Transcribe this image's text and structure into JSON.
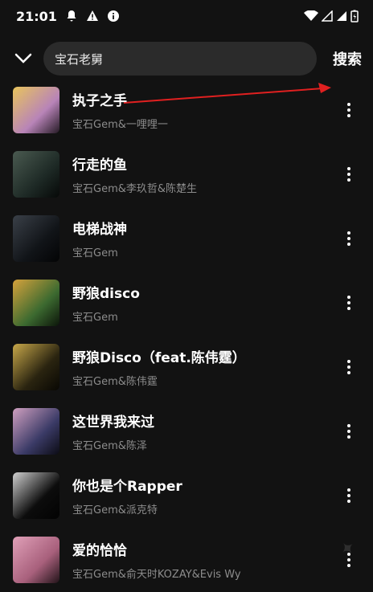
{
  "status_bar": {
    "time": "21:01"
  },
  "search": {
    "query": "宝石老舅",
    "button_label": "搜索"
  },
  "songs": [
    {
      "title": "执子之手",
      "artist": "宝石Gem&一哩哩一",
      "cover_color": "#b884b8",
      "cover_accent": "#e8c45c"
    },
    {
      "title": "行走的鱼",
      "artist": "宝石Gem&李玖哲&陈楚生",
      "cover_color": "#1e2a26",
      "cover_accent": "#4a5a50"
    },
    {
      "title": "电梯战神",
      "artist": "宝石Gem",
      "cover_color": "#111418",
      "cover_accent": "#3a4048"
    },
    {
      "title": "野狼disco",
      "artist": "宝石Gem",
      "cover_color": "#3c6a30",
      "cover_accent": "#d6a23c"
    },
    {
      "title": "野狼Disco（feat.陈伟霆）",
      "artist": "宝石Gem&陈伟霆",
      "cover_color": "#2a2410",
      "cover_accent": "#c8a84a"
    },
    {
      "title": "这世界我来过",
      "artist": "宝石Gem&陈泽",
      "cover_color": "#3a3a66",
      "cover_accent": "#d0a0c0"
    },
    {
      "title": "你也是个Rapper",
      "artist": "宝石Gem&派克特",
      "cover_color": "#0c0c0c",
      "cover_accent": "#d0d0d0"
    },
    {
      "title": "爱的恰恰",
      "artist": "宝石Gem&俞天时KOZAY&Evis Wy",
      "cover_color": "#a8607c",
      "cover_accent": "#e0a0b8"
    }
  ],
  "colors": {
    "background": "#121212",
    "search_box": "#2b2b2b",
    "subtext": "#8c8c8c",
    "annotation_arrow": "#e02020"
  }
}
